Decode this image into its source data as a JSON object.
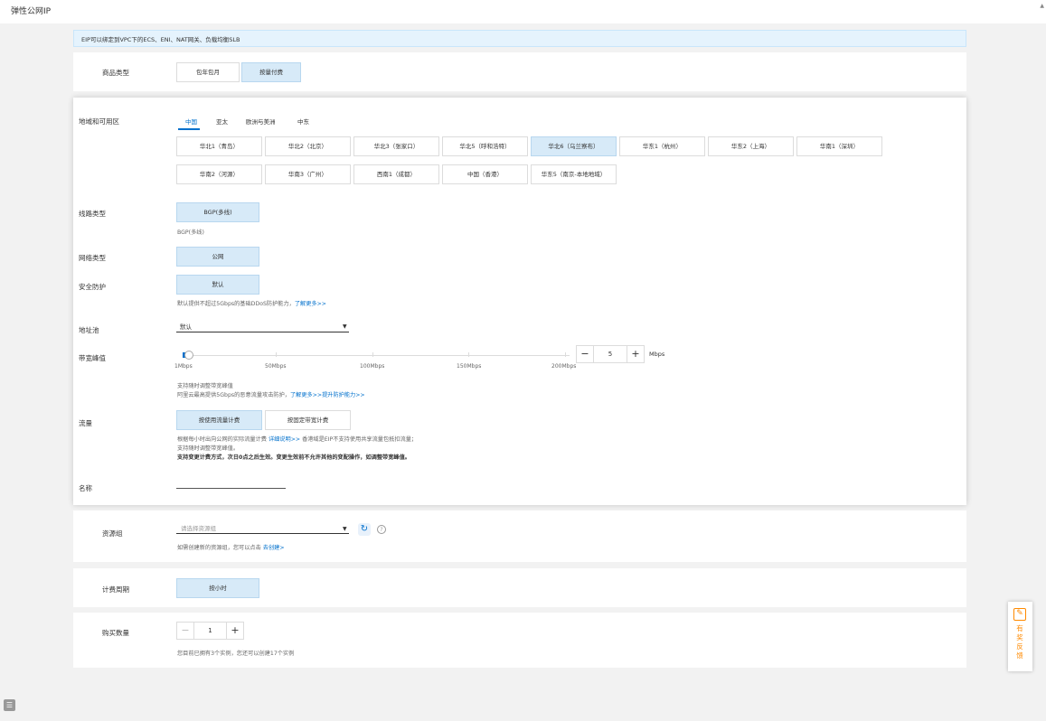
{
  "header": {
    "title": "弹性公网IP"
  },
  "notice": {
    "text": "EIP可以绑定到VPC下的ECS、ENI、NAT网关、负载均衡SLB"
  },
  "product_type": {
    "label": "商品类型",
    "options": [
      "包年包月",
      "按量付费"
    ],
    "selected": "按量付费"
  },
  "region": {
    "label": "地域和可用区",
    "tabs": [
      "中国",
      "亚太",
      "欧洲与美洲",
      "中东"
    ],
    "active_tab": "中国",
    "row1": [
      "华北1（青岛）",
      "华北2（北京）",
      "华北3（张家口）",
      "华北5（呼和浩特）",
      "华北6（乌兰察布）",
      "华东1（杭州）",
      "华东2（上海）",
      "华南1（深圳）"
    ],
    "row2": [
      "华南2（河源）",
      "华南3（广州）",
      "西南1（成都）",
      "中国（香港）",
      "华东5（南京-本地地域）"
    ],
    "selected": "华北6（乌兰察布）"
  },
  "line_type": {
    "label": "线路类型",
    "option": "BGP(多线)",
    "desc": "BGP(多线)"
  },
  "network_type": {
    "label": "网络类型",
    "option": "公网"
  },
  "security": {
    "label": "安全防护",
    "option": "默认",
    "desc": "默认提供不超过5Gbps的基础DDoS防护能力，",
    "link": "了解更多>>"
  },
  "address_pool": {
    "label": "地址池",
    "value": "默认"
  },
  "bandwidth": {
    "label": "带宽峰值",
    "ticks": [
      "1Mbps",
      "50Mbps",
      "100Mbps",
      "150Mbps",
      "200Mbps"
    ],
    "value": "5",
    "unit": "Mbps",
    "hint1": "支持随时调整带宽峰值",
    "hint2": "阿里云最高提供5Gbps的恶意流量攻击防护，",
    "hint2_link": "了解更多>>提升防护能力>>"
  },
  "traffic": {
    "label": "流量",
    "options": [
      "按使用流量计费",
      "按固定带宽计费"
    ],
    "selected": "按使用流量计费",
    "hint1_a": "根据每小时出向公网的实际流量计费",
    "hint1_link": "详细说明>>",
    "hint1_b": "香港域是EIP不支持使用共享流量包抵扣流量；",
    "hint2": "支持随时调整带宽峰值。",
    "hint3": "支持变更计费方式，次日0点之后生效。变更生效前不允许其他的变配操作，如调整带宽峰值。"
  },
  "name": {
    "label": "名称",
    "value": ""
  },
  "resource_group": {
    "label": "资源组",
    "placeholder": "请选择资源组",
    "hint": "如需创建新的资源组，您可以点击",
    "link": "去创建>"
  },
  "billing_cycle": {
    "label": "计费周期",
    "option": "按小时"
  },
  "quantity": {
    "label": "购买数量",
    "value": "1",
    "hint": "您目前已拥有3个实例，您还可以创建17个实例"
  },
  "feedback": {
    "text": "有奖反馈"
  },
  "colors": {
    "accent": "#0070cc",
    "selected_bg": "#d7eaf8",
    "feedback": "#ff8a00"
  }
}
